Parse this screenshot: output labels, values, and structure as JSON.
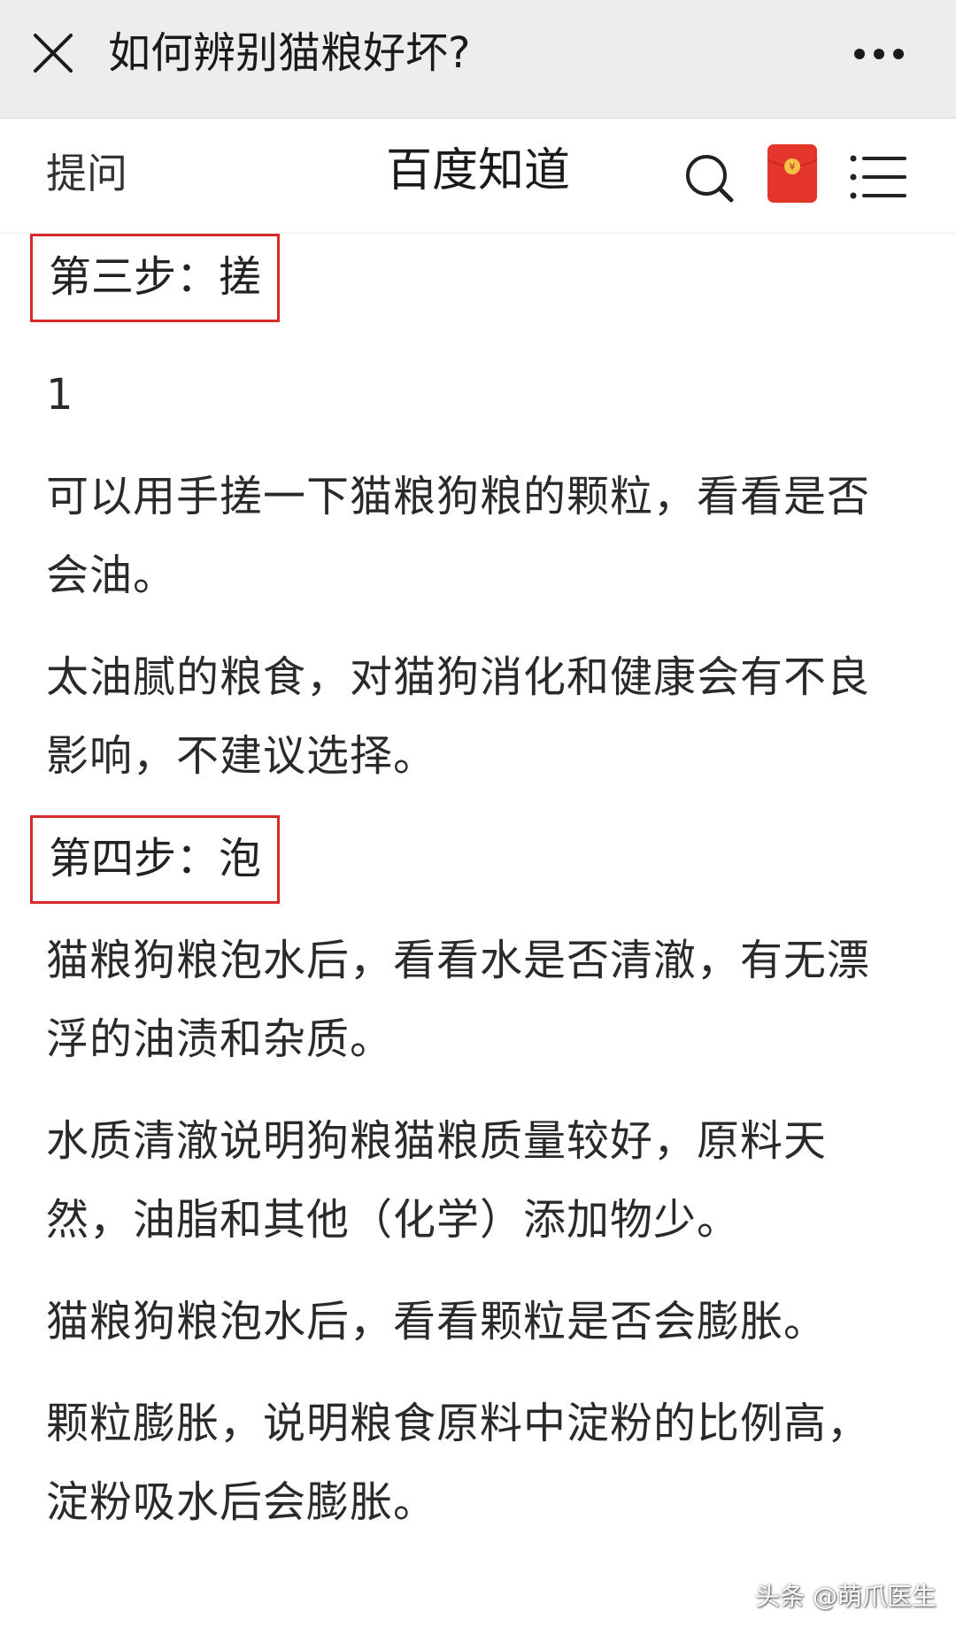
{
  "webview": {
    "title": "如何辨别猫粮好坏?",
    "close_icon": "close-icon",
    "more_icon": "more-dots-icon"
  },
  "header": {
    "ask_label": "提问",
    "site_title": "百度知道",
    "search_icon": "search-icon",
    "redpacket_icon": "red-envelope-icon",
    "menu_icon": "menu-icon"
  },
  "content": {
    "step3_title": "第三步：搓",
    "item_number": "1",
    "p1": "可以用手搓一下猫粮狗粮的颗粒，看看是否会油。",
    "p2": "太油腻的粮食，对猫狗消化和健康会有不良影响，不建议选择。",
    "step4_title": "第四步：泡",
    "p3": "猫粮狗粮泡水后，看看水是否清澈，有无漂浮的油渍和杂质。",
    "p4": "水质清澈说明狗粮猫粮质量较好，原料天然，油脂和其他（化学）添加物少。",
    "p5": "猫粮狗粮泡水后，看看颗粒是否会膨胀。",
    "p6": "颗粒膨胀，说明粮食原料中淀粉的比例高，淀粉吸水后会膨胀。"
  },
  "watermark": "头条 @萌爪医生",
  "colors": {
    "webview_bg": "#ededed",
    "highlight_border": "#d92a2a",
    "redpacket": "#e4362b",
    "redpacket_seal": "#f6c344"
  }
}
